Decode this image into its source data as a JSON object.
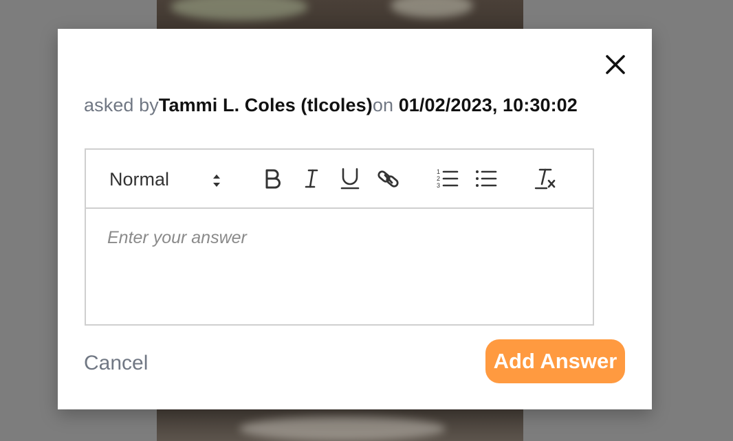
{
  "question_meta": {
    "asked_by_prefix": "asked by",
    "author": "Tammi L. Coles (tlcoles)",
    "on_prefix": "on",
    "datetime": "01/02/2023, 10:30:02"
  },
  "editor": {
    "format_label": "Normal",
    "placeholder": "Enter your answer",
    "toolbar_icons": [
      "bold-icon",
      "italic-icon",
      "underline-icon",
      "link-icon",
      "ordered-list-icon",
      "bullet-list-icon",
      "clear-format-icon"
    ]
  },
  "actions": {
    "cancel_label": "Cancel",
    "submit_label": "Add Answer"
  },
  "colors": {
    "accent": "#ff9a40",
    "muted_text": "#707783",
    "border": "#cfcfcf"
  }
}
